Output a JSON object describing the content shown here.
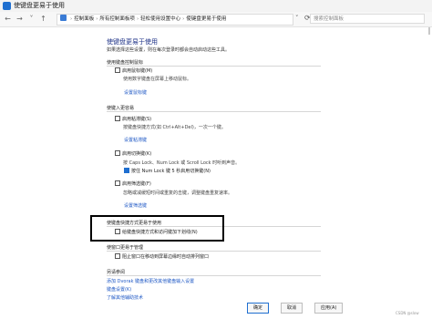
{
  "window": {
    "title": "使键盘更易于使用"
  },
  "address": {
    "crumbs": [
      "控制面板",
      "所有控制面板项",
      "轻松使用设置中心",
      "使键盘更易于使用"
    ],
    "search_placeholder": "搜索控制面板"
  },
  "page": {
    "title": "使键盘更易于使用",
    "subtitle": "如果选择这些设置，则在每次登录时都会自动启动这些工具。"
  },
  "sections": {
    "mouse": {
      "heading": "使用键盘控制鼠标",
      "option_label": "启用鼠标键(M)",
      "option_checked": false,
      "description": "使用数字键盘在屏幕上移动鼠标。",
      "link": "设置鼠标键"
    },
    "typing": {
      "heading": "使键入更容易",
      "sticky_label": "启用粘滞键(S)",
      "sticky_checked": false,
      "sticky_desc": "按键盘快捷方式(如 Ctrl+Alt+Del)，一次一个键。",
      "sticky_link": "设置粘滞键",
      "toggle_label": "启用切换键(K)",
      "toggle_checked": false,
      "toggle_desc": "按 Caps Lock、Num Lock 或 Scroll Lock 时听到声音。",
      "toggle_sub_label": "按住 Num Lock 键 5 秒启用切换键(N)",
      "toggle_sub_checked": true,
      "filter_label": "启用筛选键(F)",
      "filter_checked": false,
      "filter_desc": "忽略或减缓短时间或重复的击键，调整键盘重复速率。",
      "filter_link": "设置筛选键"
    },
    "shortcuts": {
      "heading": "使键盘快捷方式更易于使用",
      "option_label": "给键盘快捷方式和访问键加下划线(N)",
      "option_checked": false
    },
    "windows": {
      "heading": "使窗口更易于管理",
      "option_label": "阻止窗口在移动到屏幕边缘时自动排列窗口",
      "option_checked": false
    },
    "see_also": {
      "heading": "另请参阅",
      "link1": "添加 Dvorak 键盘和更改其他键盘输入设置",
      "link2": "键盘设置(K)",
      "link3": "了解其他辅助技术"
    }
  },
  "buttons": {
    "ok": "确定",
    "cancel": "取消",
    "apply": "应用(A)"
  },
  "watermark": "CSDN @slow"
}
